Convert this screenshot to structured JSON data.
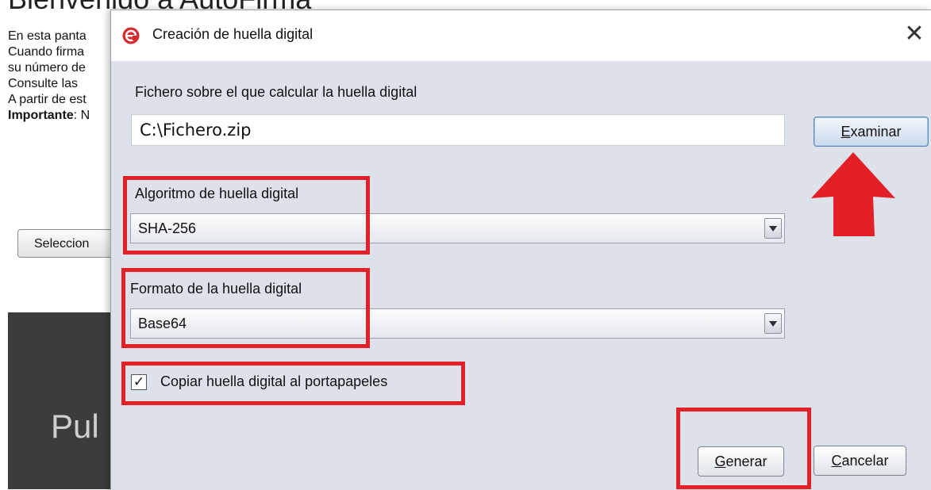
{
  "background_window": {
    "title": "Bienvenido a AutoFirma",
    "lines": [
      "En esta panta",
      "Cuando firma",
      "su número de",
      "Consulte las",
      "A partir de est"
    ],
    "important_bold": "Importante",
    "important_rest": ": N",
    "select_button_label": "Seleccion",
    "dark_panel_text": "Pul"
  },
  "dialog": {
    "title": "Creación de huella digital",
    "close_glyph": "✕",
    "file_label": "Fichero sobre el que calcular la huella digital",
    "file_value": "C:\\Fichero.zip",
    "examine_mnemonic": "E",
    "examine_rest": "xaminar",
    "algorithm_label": "Algoritmo de huella digital",
    "algorithm_value": "SHA-256",
    "format_label": "Formato de la huella digital",
    "format_value": "Base64",
    "copy_checkbox_label": "Copiar huella digital al portapapeles",
    "copy_checked": true,
    "generate_mnemonic": "G",
    "generate_rest": "enerar",
    "cancel_mnemonic": "C",
    "cancel_rest": "ancelar"
  },
  "colors": {
    "annotation_red": "#e32028",
    "dialog_background": "#dde2ea",
    "app_icon_red": "#d62a2f"
  },
  "icons": [
    "autofirma-logo-icon",
    "close-icon",
    "chevron-down-icon",
    "checkmark-icon",
    "red-arrow-icon"
  ]
}
